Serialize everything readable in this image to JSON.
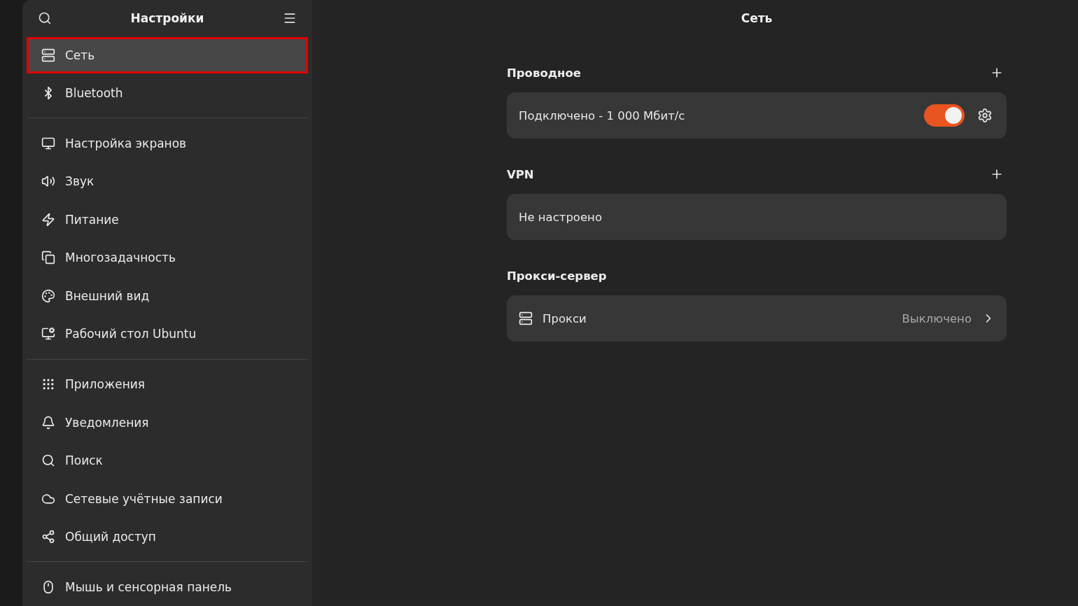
{
  "sidebar": {
    "title": "Настройки",
    "groups": [
      {
        "items": [
          {
            "label": "Сеть",
            "selected": true
          },
          {
            "label": "Bluetooth",
            "selected": false
          }
        ]
      },
      {
        "items": [
          {
            "label": "Настройка экранов",
            "selected": false
          },
          {
            "label": "Звук",
            "selected": false
          },
          {
            "label": "Питание",
            "selected": false
          },
          {
            "label": "Многозадачность",
            "selected": false
          },
          {
            "label": "Внешний вид",
            "selected": false
          },
          {
            "label": "Рабочий стол Ubuntu",
            "selected": false
          }
        ]
      },
      {
        "items": [
          {
            "label": "Приложения",
            "selected": false
          },
          {
            "label": "Уведомления",
            "selected": false
          },
          {
            "label": "Поиск",
            "selected": false
          },
          {
            "label": "Сетевые учётные записи",
            "selected": false
          },
          {
            "label": "Общий доступ",
            "selected": false
          }
        ]
      },
      {
        "items": [
          {
            "label": "Мышь и сенсорная панель",
            "selected": false
          }
        ]
      }
    ]
  },
  "page": {
    "title": "Сеть",
    "sections": [
      {
        "heading": "Проводное",
        "can_add": true,
        "rows": [
          {
            "kind": "toggle",
            "label": "Подключено - 1 000 Мбит/с",
            "on": true
          }
        ]
      },
      {
        "heading": "VPN",
        "can_add": true,
        "rows": [
          {
            "kind": "text",
            "label": "Не настроено"
          }
        ]
      },
      {
        "heading": "Прокси-сервер",
        "can_add": false,
        "rows": [
          {
            "kind": "link",
            "label": "Прокси",
            "value": "Выключено"
          }
        ]
      }
    ]
  }
}
